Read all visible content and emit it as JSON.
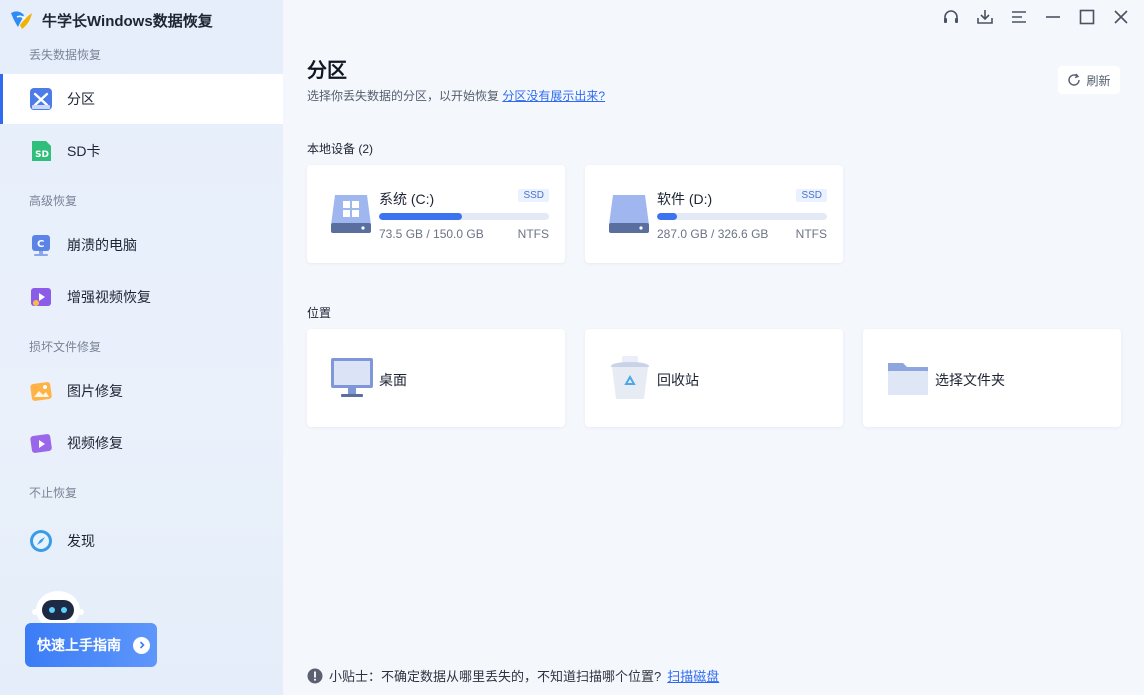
{
  "app": {
    "title": "牛学长Windows数据恢复"
  },
  "sidebar": {
    "sections": [
      {
        "label": "丢失数据恢复"
      },
      {
        "label": "高级恢复"
      },
      {
        "label": "损坏文件修复"
      },
      {
        "label": "不止恢复"
      }
    ],
    "items": [
      {
        "label": "分区",
        "icon": "partition-icon",
        "active": true
      },
      {
        "label": "SD卡",
        "icon": "sd-card-icon"
      },
      {
        "label": "崩溃的电脑",
        "icon": "crashed-pc-icon"
      },
      {
        "label": "增强视频恢复",
        "icon": "video-recovery-icon"
      },
      {
        "label": "图片修复",
        "icon": "photo-repair-icon"
      },
      {
        "label": "视频修复",
        "icon": "video-repair-icon"
      },
      {
        "label": "发现",
        "icon": "compass-icon"
      }
    ],
    "guide_button": "快速上手指南"
  },
  "window_controls": [
    "headset-icon",
    "download-icon",
    "menu-icon",
    "minimize-icon",
    "maximize-icon",
    "close-icon"
  ],
  "main": {
    "title": "分区",
    "subtitle": "选择你丢失数据的分区，以开始恢复",
    "subtitle_link": "分区没有展示出来?",
    "refresh_label": "刷新",
    "local_devices_label": "本地设备 (2)",
    "drives": [
      {
        "name": "系统 (C:)",
        "type": "SSD",
        "size": "73.5 GB / 150.0 GB",
        "fs": "NTFS",
        "used_ratio": 0.49
      },
      {
        "name": "软件 (D:)",
        "type": "SSD",
        "size": "287.0 GB / 326.6 GB",
        "fs": "NTFS",
        "used_ratio": 0.12
      }
    ],
    "locations_label": "位置",
    "locations": [
      {
        "name": "桌面",
        "icon": "desktop-icon"
      },
      {
        "name": "回收站",
        "icon": "recycle-bin-icon"
      },
      {
        "name": "选择文件夹",
        "icon": "folder-icon"
      }
    ],
    "tip": {
      "text": "小贴士：不确定数据从哪里丢失的，不知道扫描哪个位置?",
      "link": "扫描磁盘"
    }
  },
  "colors": {
    "accent": "#2f6bf2",
    "sidebar_bg": "#e6eefb",
    "main_bg": "#f4f7fc"
  }
}
